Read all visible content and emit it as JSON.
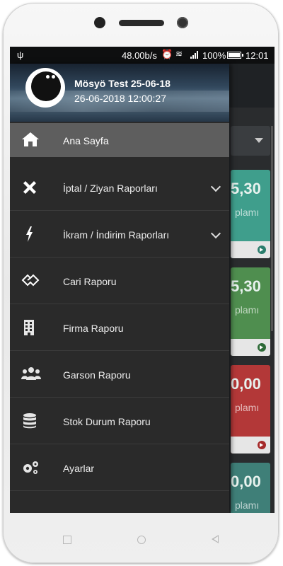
{
  "status_bar": {
    "network_speed": "48.00b/s",
    "battery_percent": "100%",
    "time": "12:01",
    "icons": [
      "usb-icon",
      "alarm-icon",
      "wifi-icon",
      "signal-icon",
      "battery-icon"
    ]
  },
  "drawer": {
    "header": {
      "user_name": "Mösyö Test 25-06-18",
      "datetime": "26-06-2018 12:00:27",
      "logo_icon": "app-logo-icon"
    },
    "items": [
      {
        "label": "Ana Sayfa",
        "icon": "home-icon",
        "active": true,
        "expandable": false
      },
      {
        "label": "İptal / Ziyan Raporları",
        "icon": "close-x-icon",
        "active": false,
        "expandable": true
      },
      {
        "label": "İkram / İndirim Raporları",
        "icon": "lightning-icon",
        "active": false,
        "expandable": true
      },
      {
        "label": "Cari Raporu",
        "icon": "handshake-icon",
        "active": false,
        "expandable": false
      },
      {
        "label": "Firma Raporu",
        "icon": "building-icon",
        "active": false,
        "expandable": false
      },
      {
        "label": "Garson Raporu",
        "icon": "users-icon",
        "active": false,
        "expandable": false
      },
      {
        "label": "Stok Durum Raporu",
        "icon": "database-icon",
        "active": false,
        "expandable": false
      },
      {
        "label": "Ayarlar",
        "icon": "gears-icon",
        "active": false,
        "expandable": false
      }
    ]
  },
  "background_cards": [
    {
      "amount_fragment": "5,30",
      "sub_fragment": "plamı",
      "color": "#3f9e8c",
      "arrow_color": "#2a7d6c"
    },
    {
      "amount_fragment": "5,30",
      "sub_fragment": "plamı",
      "color": "#4f8e4f",
      "arrow_color": "#2e6b38"
    },
    {
      "amount_fragment": "0,00",
      "sub_fragment": "plamı",
      "color": "#b33838",
      "arrow_color": "#a52a2a"
    },
    {
      "amount_fragment": "0,00",
      "sub_fragment": "plamı",
      "color": "#3f7f78",
      "arrow_color": "#2a7d6c"
    }
  ],
  "colors": {
    "drawer_bg": "#2a2a2a",
    "active_item_bg": "#5e5e5e",
    "status_bar_bg": "#0e0f10"
  }
}
